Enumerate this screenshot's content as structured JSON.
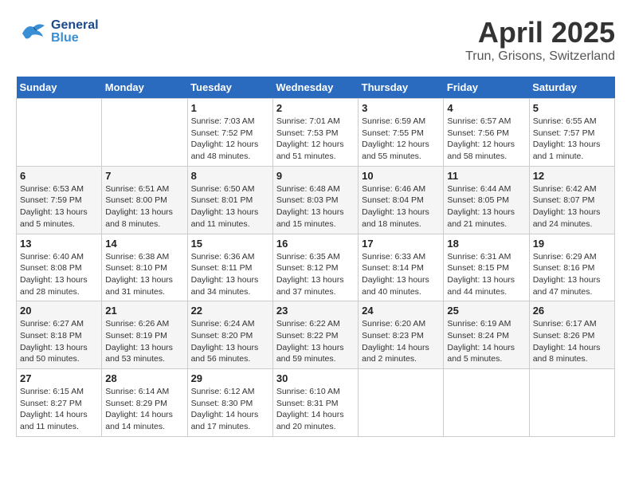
{
  "header": {
    "logo_general": "General",
    "logo_blue": "Blue",
    "main_title": "April 2025",
    "subtitle": "Trun, Grisons, Switzerland"
  },
  "calendar": {
    "headers": [
      "Sunday",
      "Monday",
      "Tuesday",
      "Wednesday",
      "Thursday",
      "Friday",
      "Saturday"
    ],
    "weeks": [
      [
        {
          "day": "",
          "info": ""
        },
        {
          "day": "",
          "info": ""
        },
        {
          "day": "1",
          "info": "Sunrise: 7:03 AM\nSunset: 7:52 PM\nDaylight: 12 hours\nand 48 minutes."
        },
        {
          "day": "2",
          "info": "Sunrise: 7:01 AM\nSunset: 7:53 PM\nDaylight: 12 hours\nand 51 minutes."
        },
        {
          "day": "3",
          "info": "Sunrise: 6:59 AM\nSunset: 7:55 PM\nDaylight: 12 hours\nand 55 minutes."
        },
        {
          "day": "4",
          "info": "Sunrise: 6:57 AM\nSunset: 7:56 PM\nDaylight: 12 hours\nand 58 minutes."
        },
        {
          "day": "5",
          "info": "Sunrise: 6:55 AM\nSunset: 7:57 PM\nDaylight: 13 hours\nand 1 minute."
        }
      ],
      [
        {
          "day": "6",
          "info": "Sunrise: 6:53 AM\nSunset: 7:59 PM\nDaylight: 13 hours\nand 5 minutes."
        },
        {
          "day": "7",
          "info": "Sunrise: 6:51 AM\nSunset: 8:00 PM\nDaylight: 13 hours\nand 8 minutes."
        },
        {
          "day": "8",
          "info": "Sunrise: 6:50 AM\nSunset: 8:01 PM\nDaylight: 13 hours\nand 11 minutes."
        },
        {
          "day": "9",
          "info": "Sunrise: 6:48 AM\nSunset: 8:03 PM\nDaylight: 13 hours\nand 15 minutes."
        },
        {
          "day": "10",
          "info": "Sunrise: 6:46 AM\nSunset: 8:04 PM\nDaylight: 13 hours\nand 18 minutes."
        },
        {
          "day": "11",
          "info": "Sunrise: 6:44 AM\nSunset: 8:05 PM\nDaylight: 13 hours\nand 21 minutes."
        },
        {
          "day": "12",
          "info": "Sunrise: 6:42 AM\nSunset: 8:07 PM\nDaylight: 13 hours\nand 24 minutes."
        }
      ],
      [
        {
          "day": "13",
          "info": "Sunrise: 6:40 AM\nSunset: 8:08 PM\nDaylight: 13 hours\nand 28 minutes."
        },
        {
          "day": "14",
          "info": "Sunrise: 6:38 AM\nSunset: 8:10 PM\nDaylight: 13 hours\nand 31 minutes."
        },
        {
          "day": "15",
          "info": "Sunrise: 6:36 AM\nSunset: 8:11 PM\nDaylight: 13 hours\nand 34 minutes."
        },
        {
          "day": "16",
          "info": "Sunrise: 6:35 AM\nSunset: 8:12 PM\nDaylight: 13 hours\nand 37 minutes."
        },
        {
          "day": "17",
          "info": "Sunrise: 6:33 AM\nSunset: 8:14 PM\nDaylight: 13 hours\nand 40 minutes."
        },
        {
          "day": "18",
          "info": "Sunrise: 6:31 AM\nSunset: 8:15 PM\nDaylight: 13 hours\nand 44 minutes."
        },
        {
          "day": "19",
          "info": "Sunrise: 6:29 AM\nSunset: 8:16 PM\nDaylight: 13 hours\nand 47 minutes."
        }
      ],
      [
        {
          "day": "20",
          "info": "Sunrise: 6:27 AM\nSunset: 8:18 PM\nDaylight: 13 hours\nand 50 minutes."
        },
        {
          "day": "21",
          "info": "Sunrise: 6:26 AM\nSunset: 8:19 PM\nDaylight: 13 hours\nand 53 minutes."
        },
        {
          "day": "22",
          "info": "Sunrise: 6:24 AM\nSunset: 8:20 PM\nDaylight: 13 hours\nand 56 minutes."
        },
        {
          "day": "23",
          "info": "Sunrise: 6:22 AM\nSunset: 8:22 PM\nDaylight: 13 hours\nand 59 minutes."
        },
        {
          "day": "24",
          "info": "Sunrise: 6:20 AM\nSunset: 8:23 PM\nDaylight: 14 hours\nand 2 minutes."
        },
        {
          "day": "25",
          "info": "Sunrise: 6:19 AM\nSunset: 8:24 PM\nDaylight: 14 hours\nand 5 minutes."
        },
        {
          "day": "26",
          "info": "Sunrise: 6:17 AM\nSunset: 8:26 PM\nDaylight: 14 hours\nand 8 minutes."
        }
      ],
      [
        {
          "day": "27",
          "info": "Sunrise: 6:15 AM\nSunset: 8:27 PM\nDaylight: 14 hours\nand 11 minutes."
        },
        {
          "day": "28",
          "info": "Sunrise: 6:14 AM\nSunset: 8:29 PM\nDaylight: 14 hours\nand 14 minutes."
        },
        {
          "day": "29",
          "info": "Sunrise: 6:12 AM\nSunset: 8:30 PM\nDaylight: 14 hours\nand 17 minutes."
        },
        {
          "day": "30",
          "info": "Sunrise: 6:10 AM\nSunset: 8:31 PM\nDaylight: 14 hours\nand 20 minutes."
        },
        {
          "day": "",
          "info": ""
        },
        {
          "day": "",
          "info": ""
        },
        {
          "day": "",
          "info": ""
        }
      ]
    ]
  }
}
